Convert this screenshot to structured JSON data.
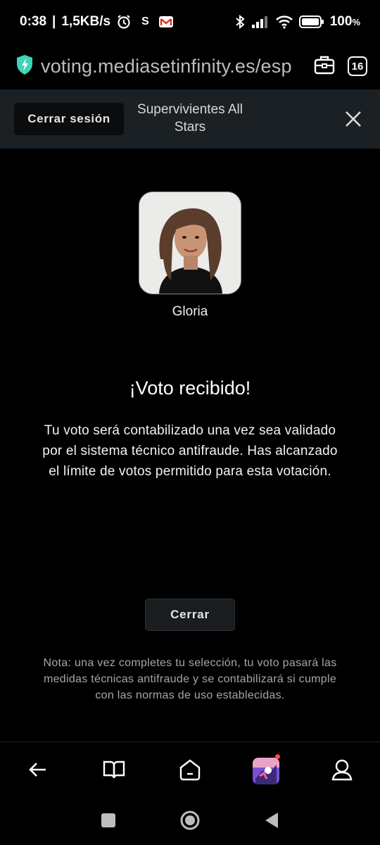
{
  "status_bar": {
    "time": "0:38",
    "network_speed": "1,5KB/s",
    "s_label": "S",
    "battery": "100",
    "battery_unit": "%"
  },
  "browser": {
    "url": "voting.mediasetinfinity.es/esp",
    "tab_count": "16"
  },
  "header": {
    "logout_label": "Cerrar sesión",
    "title": "Supervivientes All Stars"
  },
  "contestant": {
    "name": "Gloria"
  },
  "confirmation": {
    "heading": "¡Voto recibido!",
    "message": "Tu voto será contabilizado una vez sea validado por el sistema técnico antifraude. Has alcanzado el límite de votos permitido para esta votación.",
    "close_label": "Cerrar",
    "note": "Nota: una vez completes tu selección, tu voto pasará las medidas técnicas antifraude y se contabilizará si cumple con las normas de uso establecidas."
  },
  "icons": {
    "shield": "shield-bolt-icon",
    "briefcase": "briefcase-icon",
    "close": "close-icon",
    "back": "back-arrow-icon",
    "book": "book-icon",
    "home": "home-icon",
    "profile": "profile-icon"
  },
  "colors": {
    "background": "#000000",
    "header_bar": "#1b2024",
    "shield_accent": "#3fd4b8",
    "notification_dot": "#ff4a3d"
  }
}
